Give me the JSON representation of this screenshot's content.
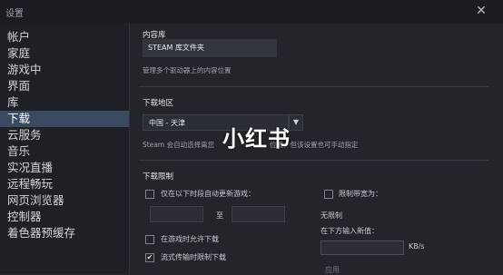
{
  "window": {
    "title": "设置",
    "close_glyph": "✕"
  },
  "sidebar": {
    "items": [
      {
        "label": "帐户"
      },
      {
        "label": "家庭"
      },
      {
        "label": "游戏中"
      },
      {
        "label": "界面"
      },
      {
        "label": "库"
      },
      {
        "label": "下载",
        "active": true
      },
      {
        "label": "云服务"
      },
      {
        "label": "音乐"
      },
      {
        "label": "实况直播"
      },
      {
        "label": "远程畅玩"
      },
      {
        "label": "网页浏览器"
      },
      {
        "label": "控制器"
      },
      {
        "label": "着色器预缓存"
      }
    ]
  },
  "content_library": {
    "title": "内容库",
    "button_label": "STEAM 库文件夹",
    "description": "管理多个驱动器上的内容位置"
  },
  "download_region": {
    "title": "下载地区",
    "selected": "中国 - 天津",
    "description_left": "Steam 会自动选择离您",
    "description_right": "位置，但该设置也可手动指定"
  },
  "download_limits": {
    "title": "下载限制",
    "schedule_label": "仅在以下时段自动更新游戏：",
    "to_label": "至",
    "bandwidth_label": "限制带宽为：",
    "no_limit": "无限制",
    "enter_value_label": "在下方输入新值：",
    "unit": "KB/s",
    "apply_label": "应用",
    "allow_ingame_label": "在游戏时允许下载",
    "throttle_streaming_label": "流式传输时限制下载",
    "throttle_checked": true
  },
  "watermark": {
    "text": "小红书"
  },
  "icons": {
    "dropdown": "chevron-down-icon",
    "check": "checkmark-icon"
  }
}
